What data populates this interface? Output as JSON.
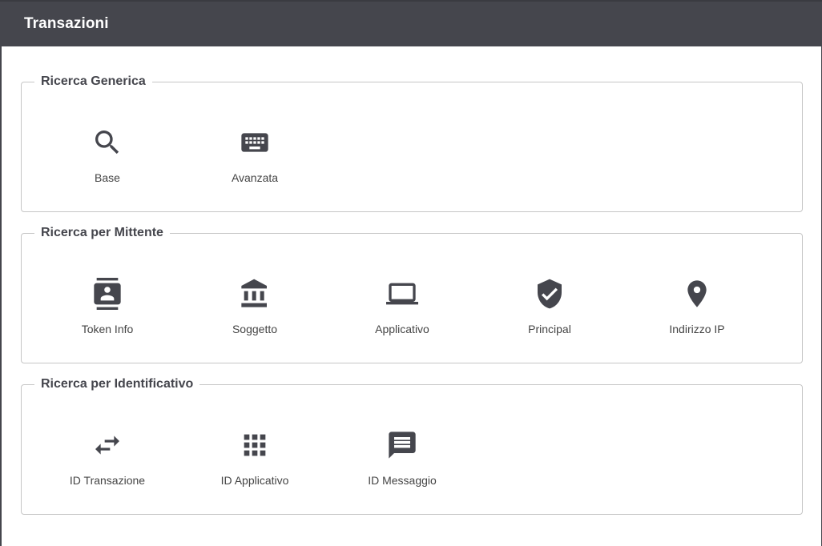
{
  "header": {
    "title": "Transazioni"
  },
  "sections": [
    {
      "legend": "Ricerca Generica",
      "items": [
        {
          "label": "Base",
          "icon": "search-icon"
        },
        {
          "label": "Avanzata",
          "icon": "keyboard-icon"
        }
      ]
    },
    {
      "legend": "Ricerca per Mittente",
      "items": [
        {
          "label": "Token Info",
          "icon": "contact-card-icon"
        },
        {
          "label": "Soggetto",
          "icon": "bank-icon"
        },
        {
          "label": "Applicativo",
          "icon": "laptop-icon"
        },
        {
          "label": "Principal",
          "icon": "verified-shield-icon"
        },
        {
          "label": "Indirizzo IP",
          "icon": "location-pin-icon"
        }
      ]
    },
    {
      "legend": "Ricerca per Identificativo",
      "items": [
        {
          "label": "ID Transazione",
          "icon": "swap-arrows-icon"
        },
        {
          "label": "ID Applicativo",
          "icon": "apps-grid-icon"
        },
        {
          "label": "ID Messaggio",
          "icon": "message-icon"
        }
      ]
    }
  ],
  "colors": {
    "header_bg": "#45464d",
    "icon": "#45464d",
    "border": "#c6c6c6"
  }
}
